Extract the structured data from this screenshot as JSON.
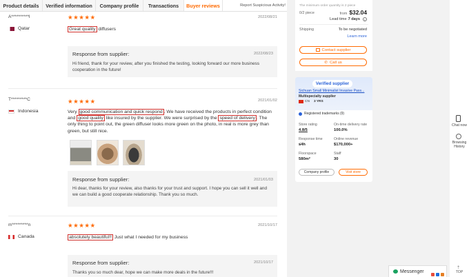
{
  "tabs": [
    {
      "label": "Product details"
    },
    {
      "label": "Verified information"
    },
    {
      "label": "Company profile"
    },
    {
      "label": "Transactions"
    },
    {
      "label": "Buyer reviews"
    }
  ],
  "report_link": "Report Suspicious Activity!",
  "reviews": [
    {
      "name": "A**********l",
      "country": "Qatar",
      "stars": "★★★★★",
      "date": "2022/08/21",
      "text_hl1": "Great quality",
      "text_rest": " diffusers",
      "response_title": "Response from supplier:",
      "response_date": "2022/08/23",
      "response_text": "Hi friend, thank for your review, after you finished the testing, looking forward our more business cooperation in the future!"
    },
    {
      "name": "T*********C",
      "country": "Indonesia",
      "stars": "★★★★★",
      "date": "2021/01/02",
      "t1": "Very ",
      "hl1": "good communication and quick respond",
      "t2": ". We have received the products in perfect condition and ",
      "hl2": "good quality",
      "t3": " like insured by the supplier. We were surprised by the ",
      "hl3": "speed of delivery",
      "t4": ". The only thing to point out, the green diffuser looks more green on the photo, in real is more grey than green, but still nice.",
      "response_title": "Response from supplier:",
      "response_date": "2021/01/03",
      "response_text": "Hi dear, thanks for your review, also thanks for your trust and support. I hope you can sell it well and we can build a good cooperate relationship. Thank you so much."
    },
    {
      "name": "m*********n",
      "country": "Canada",
      "stars": "★★★★★",
      "date": "2021/10/17",
      "hl1": "absolutely beautiful!!",
      "t1": " Just what I needed for my business",
      "response_title": "Response from supplier:",
      "response_date": "2021/10/17",
      "response_text": "Thanks you so much dear, hope we can make more deals in the future!!!"
    }
  ],
  "sidebar": {
    "min_qty_note": "The minimum order quantity is 2 piece",
    "qty_label": "0/2 piece",
    "from_label": "from",
    "price": "$32.04",
    "lead_label": "Lead time",
    "lead_value": "7 days",
    "shipping_label": "Shipping",
    "shipping_value": "To be negotiated",
    "learn_more": "Learn more",
    "contact_btn": "Contact supplier",
    "call_btn": "Call us",
    "verified_badge": "Verified supplier",
    "company_name": "Sichuan Small Minimalist Invasive Pass...",
    "company_type": "Multispecialty supplier",
    "country_code": "CN",
    "years": "3 YRS",
    "trademarks": "Registered trademarks (9)",
    "stats": [
      {
        "label": "Store rating",
        "value": "4.8/5"
      },
      {
        "label": "On-time delivery rate",
        "value": "100.0%"
      },
      {
        "label": "Response time",
        "value": "≤4h"
      },
      {
        "label": "Online revenue",
        "value": "$170,000+"
      },
      {
        "label": "Floorspace",
        "value": "580m²"
      },
      {
        "label": "Staff",
        "value": "30"
      }
    ],
    "company_profile_btn": "Company profile",
    "visit_store_btn": "Visit store"
  },
  "rail": {
    "chat": "Chat now",
    "history": "Browsing History",
    "top": "TOP"
  },
  "messenger": {
    "label": "Messenger"
  }
}
